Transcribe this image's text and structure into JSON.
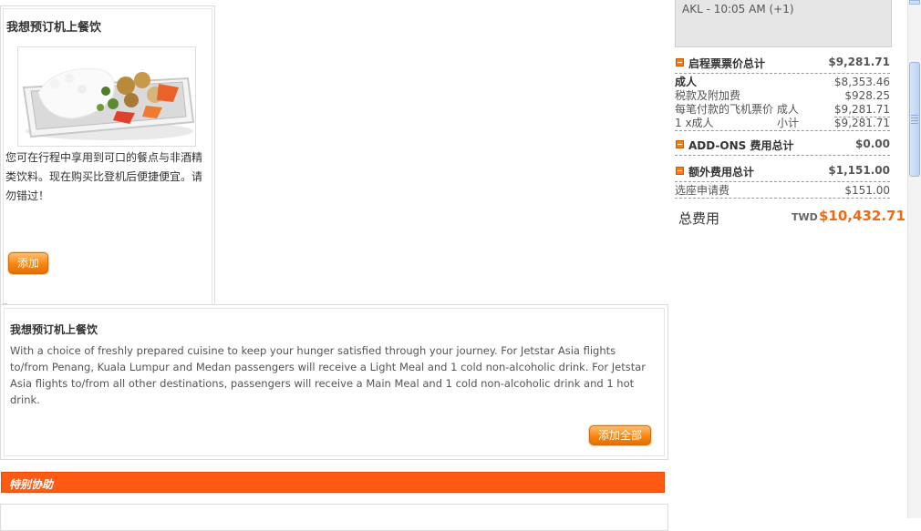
{
  "meal": {
    "title": "我想预订机上餐饮",
    "description": "您可在行程中享用到可口的餐点与非酒精类饮料。现在购买比登机后便捷便宜。请勿错过！",
    "add_label": "添加",
    "image_icon": "meal-tray-image"
  },
  "details": {
    "title": "我想预订机上餐饮",
    "body": "With a choice of freshly prepared cuisine to keep your hunger satisfied through your journey. For Jetstar Asia flights to/from Penang, Kuala Lumpur and Medan passengers will receive a Light Meal and 1 cold non-alcoholic drink. For Jetstar Asia flights to/from all other destinations, passengers will receive a Main Meal and 1 cold non-alcoholic drink and 1 hot drink.",
    "add_all_label": "添加全部"
  },
  "special_assistance": {
    "label": "特别协助"
  },
  "summary": {
    "flight_line": "AKL - 10:05 AM (+1)",
    "outbound": {
      "label": "启程票票价总计",
      "value": "$9,281.71",
      "rows": {
        "adult": {
          "label": "成人",
          "value": "$8,353.46"
        },
        "taxes": {
          "label": "税款及附加费",
          "value": "$928.25"
        },
        "per_payment": {
          "label": "每笔付款的飞机票价 成人",
          "value": "$9,281.71"
        },
        "count": {
          "label": "1 x成人",
          "mid": "小计",
          "value": "$9,281.71"
        }
      }
    },
    "addons": {
      "label": "ADD-ONS 费用总计",
      "value": "$0.00"
    },
    "extras": {
      "label": "额外费用总计",
      "value": "$1,151.00",
      "rows": {
        "seat": {
          "label": "选座申请费",
          "value": "$151.00"
        }
      }
    },
    "total": {
      "label": "总费用",
      "currency": "TWD",
      "value": "$10,432.71"
    }
  },
  "colors": {
    "accent": "#ff5a11",
    "button": "#f7860e",
    "total": "#ef6a13"
  }
}
